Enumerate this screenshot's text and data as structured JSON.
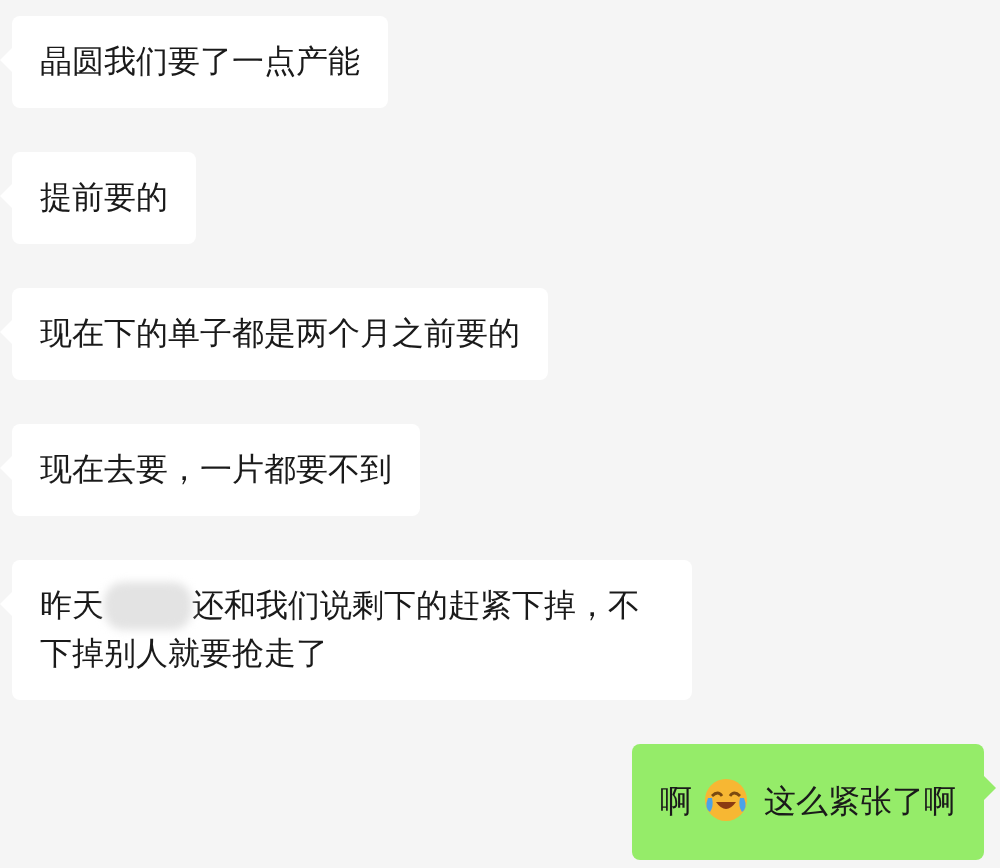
{
  "messages": [
    {
      "sent": false,
      "parts": [
        {
          "kind": "text",
          "text": "晶圆我们要了一点产能"
        }
      ]
    },
    {
      "sent": false,
      "parts": [
        {
          "kind": "text",
          "text": "提前要的"
        }
      ]
    },
    {
      "sent": false,
      "parts": [
        {
          "kind": "text",
          "text": "现在下的单子都是两个月之前要的"
        }
      ]
    },
    {
      "sent": false,
      "parts": [
        {
          "kind": "text",
          "text": "现在去要，一片都要不到"
        }
      ]
    },
    {
      "sent": false,
      "parts": [
        {
          "kind": "text",
          "text": "昨天"
        },
        {
          "kind": "redacted"
        },
        {
          "kind": "text",
          "text": "还和我们说剩下的赶紧下掉，不下掉别人就要抢走了"
        }
      ]
    },
    {
      "sent": true,
      "parts": [
        {
          "kind": "text",
          "text": "啊"
        },
        {
          "kind": "emoji"
        },
        {
          "kind": "text",
          "text": "这么紧张了啊"
        }
      ]
    }
  ]
}
